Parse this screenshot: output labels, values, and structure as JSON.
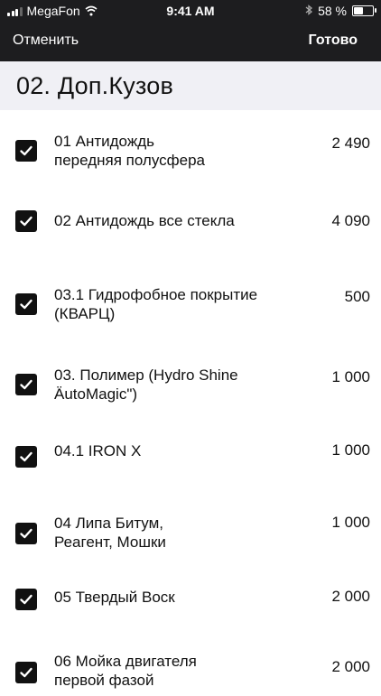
{
  "status_bar": {
    "carrier": "MegaFon",
    "time": "9:41 AM",
    "battery_text": "58 %",
    "battery_level": 0.58,
    "icons": [
      "signal-icon",
      "wifi-icon",
      "bluetooth-icon",
      "battery-icon"
    ]
  },
  "navbar": {
    "cancel_label": "Отменить",
    "done_label": "Готово"
  },
  "section": {
    "title": "02. Доп.Кузов"
  },
  "items": [
    {
      "line1": "01 Антидождь",
      "line2": "передняя полусфера",
      "price": "2 490",
      "checked": true
    },
    {
      "line1": "02 Антидождь все стекла",
      "line2": "",
      "price": "4 090",
      "checked": true
    },
    {
      "line1": "03.1 Гидрофобное покрытие",
      "line2": "(КВАРЦ)",
      "price": "500",
      "checked": true
    },
    {
      "line1": "03. Полимер (Hydro Shine",
      "line2": "ÄutoMagic\")",
      "price": "1 000",
      "checked": true
    },
    {
      "line1": "04.1 IRON X",
      "line2": "",
      "price": "1 000",
      "checked": true
    },
    {
      "line1": "04 Липа Битум,",
      "line2": "Реагент, Мошки",
      "price": "1 000",
      "checked": true
    },
    {
      "line1": "05 Твердый Воск",
      "line2": "",
      "price": "2 000",
      "checked": true
    },
    {
      "line1": "06 Мойка двигателя",
      "line2": "первой фазой",
      "price": "2 000",
      "checked": true
    }
  ],
  "colors": {
    "topbar_bg": "#1d1d1f",
    "header_bg": "#f0f0f5",
    "checkbox": "#111111"
  }
}
